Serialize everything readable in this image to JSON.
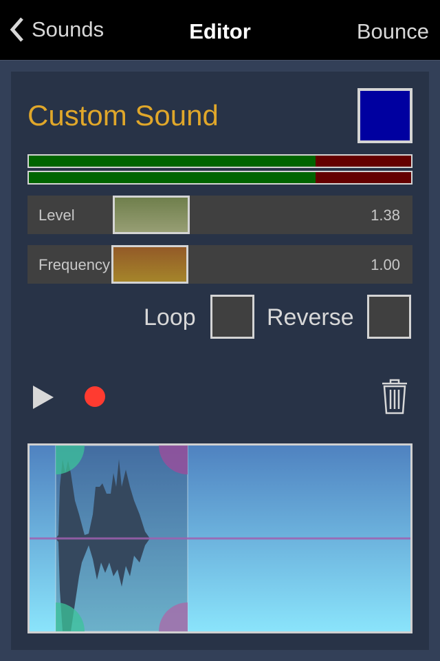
{
  "nav": {
    "back_label": "Sounds",
    "title": "Editor",
    "bounce_label": "Bounce"
  },
  "sound": {
    "name": "Custom Sound",
    "color": "#0000a0"
  },
  "meters": [
    {
      "level": 0.75
    },
    {
      "level": 0.75
    }
  ],
  "sliders": [
    {
      "label": "Level",
      "value": "1.38",
      "thumb_color_top": "#6f7f4c",
      "thumb_color_bottom": "#979e74"
    },
    {
      "label": "Frequency",
      "value": "1.00",
      "thumb_color_top": "#935a28",
      "thumb_color_bottom": "#a5852a"
    }
  ],
  "options": {
    "loop_label": "Loop",
    "loop_checked": false,
    "reverse_label": "Reverse",
    "reverse_checked": false
  },
  "transport": {
    "play_icon": "play-icon",
    "record_icon": "record-icon",
    "record_color": "#ff3b30",
    "trash_icon": "trash-icon"
  },
  "waveform": {
    "selection_start": 0.07,
    "selection_end": 0.41,
    "start_handle_color": "#3cc39a",
    "end_handle_color": "#96509c"
  }
}
